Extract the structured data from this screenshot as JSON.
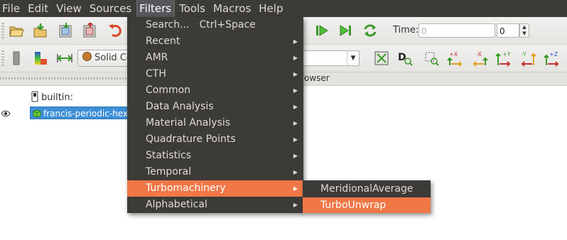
{
  "menubar": {
    "items": [
      "File",
      "Edit",
      "View",
      "Sources",
      "Filters",
      "Tools",
      "Macros",
      "Help"
    ],
    "open_menu": "Filters"
  },
  "toolbar": {
    "time_label": "Time:",
    "time_value": "0",
    "timestep_value": "0",
    "color_by_label": "Solid Color"
  },
  "panel": {
    "browser_tab_label": "owser"
  },
  "pipeline": {
    "builtin_label": "builtin:",
    "source_label": "francis-periodic-hex-mesh"
  },
  "filters_menu": {
    "items": [
      {
        "label": "Search...",
        "shortcut": "Ctrl+Space",
        "submenu": false
      },
      {
        "label": "Recent",
        "submenu": true
      },
      {
        "label": "AMR",
        "submenu": true
      },
      {
        "label": "CTH",
        "submenu": true
      },
      {
        "label": "Common",
        "submenu": true
      },
      {
        "label": "Data Analysis",
        "submenu": true
      },
      {
        "label": "Material Analysis",
        "submenu": true
      },
      {
        "label": "Quadrature Points",
        "submenu": true
      },
      {
        "label": "Statistics",
        "submenu": true
      },
      {
        "label": "Temporal",
        "submenu": true
      },
      {
        "label": "Turbomachinery",
        "submenu": true,
        "highlighted": true
      },
      {
        "label": "Alphabetical",
        "submenu": true
      }
    ]
  },
  "turbo_submenu": {
    "items": [
      {
        "label": "MeridionalAverage"
      },
      {
        "label": "TurboUnwrap",
        "highlighted": true
      }
    ]
  },
  "colors": {
    "menu_bg": "#3c3b37",
    "menu_text": "#dfdbd2",
    "highlight": "#f07746",
    "selection": "#3d8fd6"
  }
}
